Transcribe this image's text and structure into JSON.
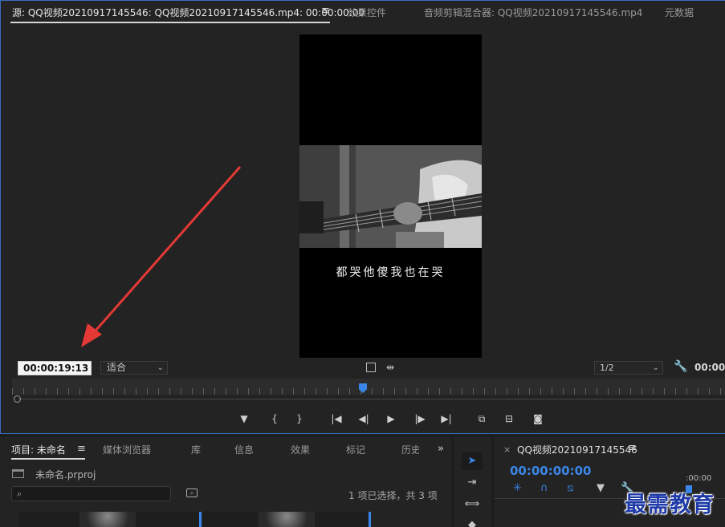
{
  "source_monitor": {
    "tabs": [
      {
        "label": "源: QQ视频20210917145546: QQ视频20210917145546.mp4: 00:00:00:00",
        "active": true
      },
      {
        "label": "效果控件"
      },
      {
        "label": "音频剪辑混合器: QQ视频20210917145546.mp4"
      },
      {
        "label": "元数据"
      }
    ],
    "menu_icon": "≡",
    "subtitle": "都哭他傻我也在哭",
    "timecode": "00:00:19:13",
    "fit": "适合",
    "resolution": "1/2",
    "right_timecode": "00:00"
  },
  "project_panel": {
    "tabs": [
      {
        "label": "项目: 未命名",
        "active": true
      },
      {
        "label": "媒体浏览器"
      },
      {
        "label": "库"
      },
      {
        "label": "信息"
      },
      {
        "label": "效果"
      },
      {
        "label": "标记"
      },
      {
        "label": "历史"
      }
    ],
    "menu_icon": "≡",
    "more_icon": "»",
    "file": "未命名.prproj",
    "selection_info": "1 项已选择，共 3 项",
    "search_placeholder": ""
  },
  "timeline": {
    "close": "×",
    "name": "QQ视频20210917145546",
    "menu_icon": "≡",
    "timecode": "00:00:00:00",
    "ruler_time": ":00:00"
  },
  "watermark": "最需教育",
  "colors": {
    "accent_blue": "#3a86e8",
    "panel_bg": "#232323",
    "arrow_red": "#e53935",
    "watermark": "#1e3aa8"
  }
}
